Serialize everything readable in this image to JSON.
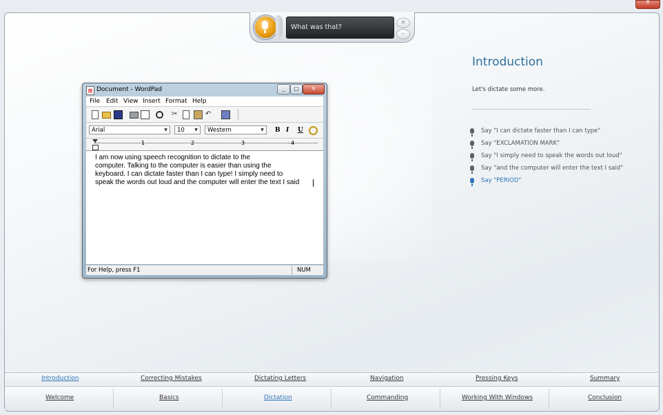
{
  "window": {
    "close_label": "x"
  },
  "speech": {
    "status_text": "What was that?",
    "close_glyph": "✕",
    "minimize_glyph": "–"
  },
  "wordpad": {
    "title": "Document - WordPad",
    "caption_buttons": [
      "_",
      "□",
      "✕"
    ],
    "menu": [
      "File",
      "Edit",
      "View",
      "Insert",
      "Format",
      "Help"
    ],
    "font": "Arial",
    "size": "10",
    "script": "Western",
    "format_buttons": [
      "B",
      "I",
      "U"
    ],
    "ruler_numbers": [
      "1",
      "2",
      "3",
      "4"
    ],
    "lines": [
      "I am now using speech recognition to dictate to the",
      "computer.  Talking to the computer is easier than using the",
      "keyboard.  I can dictate faster than I can type!  I simply need to",
      "speak the words out loud and the computer will enter the text I said"
    ],
    "status_left": "For Help, press F1",
    "status_right": "NUM"
  },
  "panel": {
    "title": "Introduction",
    "subtitle": "Let's dictate some more.",
    "steps": [
      "Say \"I can dictate faster than I can type\"",
      "Say \"EXCLAMATION MARK\"",
      "Say \"I simply need to speak the words out loud\"",
      "Say \"and the computer will enter the text I said\"",
      "Say \"PERIOD\""
    ],
    "active_step_index": 4
  },
  "subnav": [
    "Introduction",
    "Correcting Mistakes",
    "Dictating Letters",
    "Navigation",
    "Pressing Keys",
    "Summary"
  ],
  "mainnav": [
    "Welcome",
    "Basics",
    "Dictation",
    "Commanding",
    "Working With Windows",
    "Conclusion"
  ]
}
